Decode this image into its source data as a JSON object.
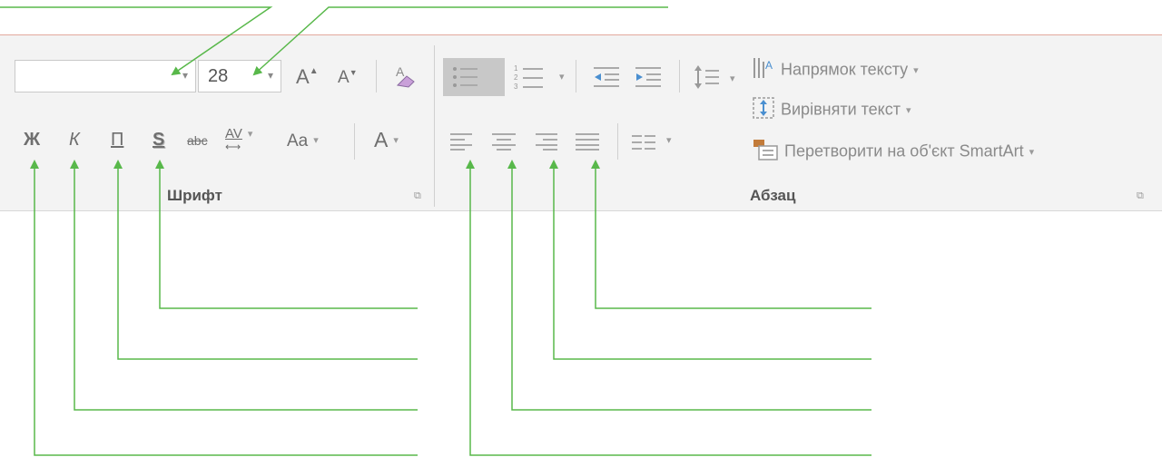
{
  "font_group": {
    "label": "Шрифт",
    "font_name": "",
    "font_size": "28",
    "grow_font": "A",
    "shrink_font": "A",
    "bold": "Ж",
    "italic": "К",
    "underline": "П",
    "shadow": "S",
    "strikethrough": "abc",
    "spacing": "AV",
    "change_case": "Aa",
    "font_color": "A"
  },
  "paragraph_group": {
    "label": "Абзац",
    "text_direction": "Напрямок тексту",
    "align_text": "Вирівняти текст",
    "smartart": "Перетворити на об'єкт SmartArt"
  },
  "colors": {
    "ribbon_bg": "#f3f3f3",
    "callout_line": "#58b84a",
    "top_border": "#e2a89d"
  },
  "icons": [
    "chevron-down-icon",
    "grow-font-icon",
    "shrink-font-icon",
    "clear-formatting-icon",
    "bullets-icon",
    "numbering-icon",
    "decrease-indent-icon",
    "increase-indent-icon",
    "line-spacing-icon",
    "align-left-icon",
    "align-center-icon",
    "align-right-icon",
    "justify-icon",
    "columns-icon",
    "dialog-launcher-icon"
  ]
}
